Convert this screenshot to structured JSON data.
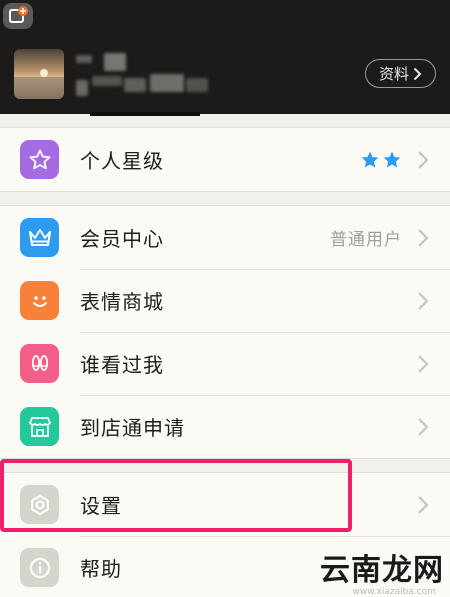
{
  "header": {
    "profile_button_label": "资料",
    "nickname_masked": "",
    "signature_masked": ""
  },
  "groups": [
    {
      "items": [
        {
          "label": "个人星级",
          "icon": "star-icon",
          "color": "#a56be0",
          "stars": 2
        }
      ]
    },
    {
      "items": [
        {
          "label": "会员中心",
          "icon": "crown-icon",
          "color": "#2d9cf0",
          "value": "普通用户"
        },
        {
          "label": "表情商城",
          "icon": "smiley-icon",
          "color": "#f7813a"
        },
        {
          "label": "谁看过我",
          "icon": "footprint-icon",
          "color": "#f35f86"
        },
        {
          "label": "到店通申请",
          "icon": "store-icon",
          "color": "#23c99a"
        }
      ]
    },
    {
      "items": [
        {
          "label": "设置",
          "icon": "gear-icon",
          "color": "#d6d5cc"
        },
        {
          "label": "帮助",
          "icon": "info-icon",
          "color": "#d6d5cc"
        }
      ]
    }
  ],
  "watermark": {
    "text": "云南龙网",
    "url": "www.xiazaiba.com"
  },
  "colors": {
    "header_bg": "#1c1b19",
    "page_bg": "#f1f0ea",
    "highlight": "#f01f6b",
    "star": "#2d9cf0"
  }
}
